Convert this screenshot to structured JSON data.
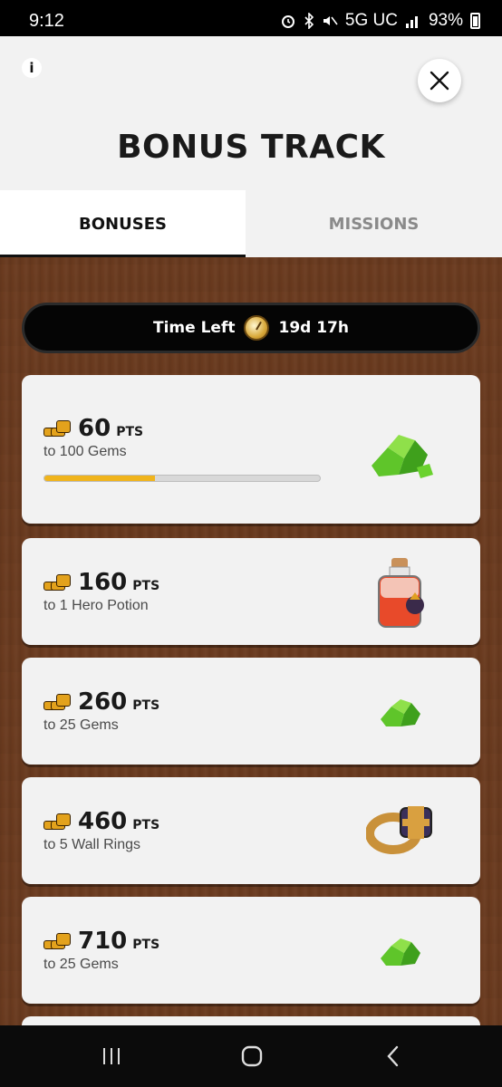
{
  "status_bar": {
    "time": "9:12",
    "network": "5G UC",
    "battery": "93%"
  },
  "header": {
    "title": "BONUS TRACK",
    "info_label": "i",
    "tabs": [
      {
        "label": "BONUSES",
        "active": true
      },
      {
        "label": "MISSIONS",
        "active": false
      }
    ]
  },
  "timer": {
    "label": "Time Left",
    "value": "19d 17h"
  },
  "bonuses": [
    {
      "points": "60",
      "unit": "PTS",
      "reward": "to 100 Gems",
      "progress": 0.4,
      "icon": "gem-pile-icon"
    },
    {
      "points": "160",
      "unit": "PTS",
      "reward": "to 1 Hero Potion",
      "icon": "hero-potion-icon"
    },
    {
      "points": "260",
      "unit": "PTS",
      "reward": "to 25 Gems",
      "icon": "gem-icon"
    },
    {
      "points": "460",
      "unit": "PTS",
      "reward": "to 5 Wall Rings",
      "icon": "wall-ring-icon"
    },
    {
      "points": "710",
      "unit": "PTS",
      "reward": "to 25 Gems",
      "icon": "gem-icon"
    }
  ],
  "colors": {
    "accent_progress": "#f0b41c",
    "wood_background": "#6b3b1f",
    "card_background": "#f2f2f2"
  }
}
